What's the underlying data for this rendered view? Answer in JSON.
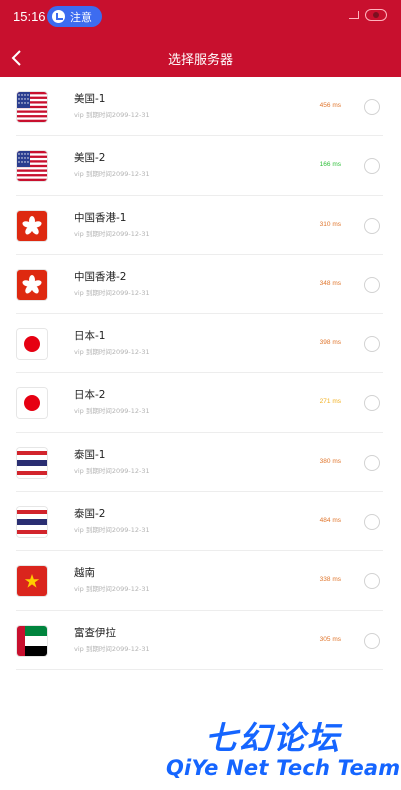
{
  "status_bar": {
    "time": "15:16",
    "notice_label": "注意"
  },
  "header": {
    "title": "选择服务器",
    "back_icon": "chevron-left-icon"
  },
  "servers": [
    {
      "name": "美国-1",
      "sub": "vip 到期时间2099-12-31",
      "ping": "456 ms",
      "ping_color": "#e0762d",
      "flag": "us"
    },
    {
      "name": "美国-2",
      "sub": "vip 到期时间2099-12-31",
      "ping": "166 ms",
      "ping_color": "#2fbf3a",
      "flag": "us"
    },
    {
      "name": "中国香港-1",
      "sub": "vip 到期时间2099-12-31",
      "ping": "310 ms",
      "ping_color": "#e0762d",
      "flag": "hk"
    },
    {
      "name": "中国香港-2",
      "sub": "vip 到期时间2099-12-31",
      "ping": "348 ms",
      "ping_color": "#e0762d",
      "flag": "hk"
    },
    {
      "name": "日本-1",
      "sub": "vip 到期时间2099-12-31",
      "ping": "398 ms",
      "ping_color": "#e0762d",
      "flag": "jp"
    },
    {
      "name": "日本-2",
      "sub": "vip 到期时间2099-12-31",
      "ping": "271 ms",
      "ping_color": "#f2b020",
      "flag": "jp"
    },
    {
      "name": "泰国-1",
      "sub": "vip 到期时间2099-12-31",
      "ping": "380 ms",
      "ping_color": "#e0762d",
      "flag": "th"
    },
    {
      "name": "泰国-2",
      "sub": "vip 到期时间2099-12-31",
      "ping": "484 ms",
      "ping_color": "#e0762d",
      "flag": "th"
    },
    {
      "name": "越南",
      "sub": "vip 到期时间2099-12-31",
      "ping": "338 ms",
      "ping_color": "#e0762d",
      "flag": "vn"
    },
    {
      "name": "富查伊拉",
      "sub": "vip 到期时间2099-12-31",
      "ping": "305 ms",
      "ping_color": "#e0762d",
      "flag": "ae"
    }
  ],
  "watermark": {
    "title": "七幻论坛",
    "subtitle": "QiYe Net Tech Team"
  },
  "colors": {
    "header_bg": "#c8102e",
    "notice_pill": "#3d6cf0",
    "watermark": "#1565ff"
  }
}
